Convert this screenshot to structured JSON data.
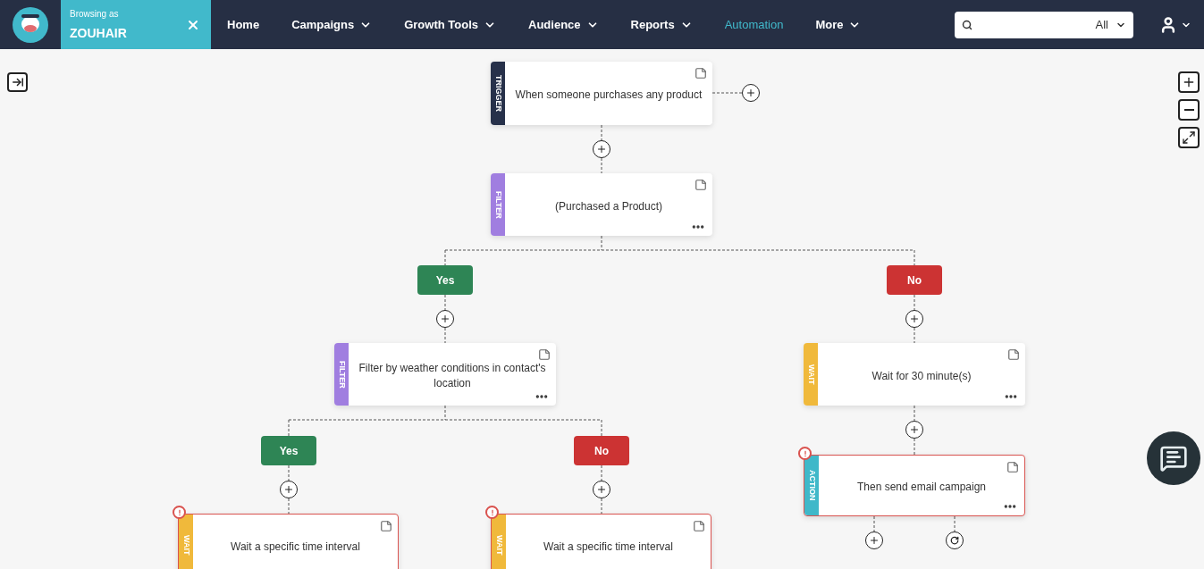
{
  "header": {
    "browsing": {
      "label": "Browsing as",
      "name": "ZOUHAIR"
    },
    "nav": [
      {
        "label": "Home",
        "dropdown": false,
        "selected": false
      },
      {
        "label": "Campaigns",
        "dropdown": true,
        "selected": false
      },
      {
        "label": "Growth Tools",
        "dropdown": true,
        "selected": false
      },
      {
        "label": "Audience",
        "dropdown": true,
        "selected": false
      },
      {
        "label": "Reports",
        "dropdown": true,
        "selected": false
      },
      {
        "label": "Automation",
        "dropdown": false,
        "selected": true
      },
      {
        "label": "More",
        "dropdown": true,
        "selected": false
      }
    ],
    "search": {
      "scope": "All"
    }
  },
  "flow": {
    "nodes": [
      {
        "kind": "trigger",
        "tag": "TRIGGER",
        "text": "When someone purchases any product",
        "menu": false,
        "error": false
      },
      {
        "kind": "filter",
        "tag": "FILTER",
        "text": "(Purchased a Product)",
        "menu": true,
        "error": false
      },
      {
        "kind": "filter",
        "tag": "FILTER",
        "text": "Filter by weather conditions in contact's location",
        "menu": true,
        "error": false
      },
      {
        "kind": "wait",
        "tag": "WAIT",
        "text": "Wait for 30 minute(s)",
        "menu": true,
        "error": false
      },
      {
        "kind": "action",
        "tag": "ACTION",
        "text": "Then send email campaign",
        "menu": true,
        "error": true
      },
      {
        "kind": "wait",
        "tag": "WAIT",
        "text": "Wait a specific time interval",
        "menu": false,
        "error": true
      },
      {
        "kind": "wait",
        "tag": "WAIT",
        "text": "Wait a specific time interval",
        "menu": false,
        "error": true
      }
    ],
    "branches": [
      {
        "kind": "yes",
        "label": "Yes"
      },
      {
        "kind": "no",
        "label": "No"
      },
      {
        "kind": "yes",
        "label": "Yes"
      },
      {
        "kind": "no",
        "label": "No"
      }
    ]
  }
}
